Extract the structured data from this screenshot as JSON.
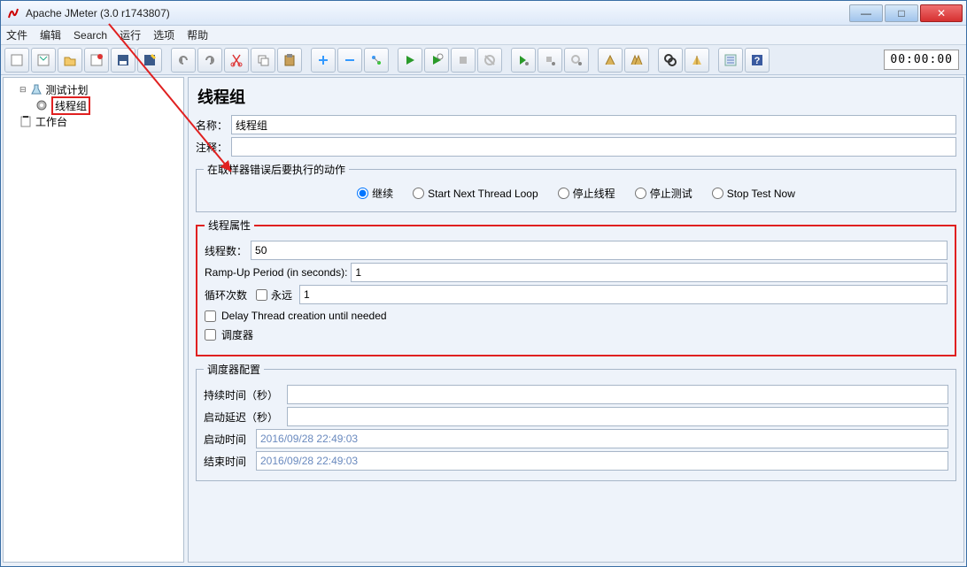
{
  "window": {
    "title": "Apache JMeter (3.0 r1743807)"
  },
  "menu": {
    "file": "文件",
    "edit": "编辑",
    "search": "Search",
    "run": "运行",
    "options": "选项",
    "help": "帮助"
  },
  "timer": "00:00:00",
  "tree": {
    "plan": "测试计划",
    "threadgroup": "线程组",
    "workbench": "工作台"
  },
  "panel": {
    "title": "线程组",
    "name_label": "名称：",
    "name_value": "线程组",
    "comment_label": "注释：",
    "comment_value": "",
    "sampler_error_legend": "在取样器错误后要执行的动作",
    "radios": {
      "continue": "继续",
      "startnext": "Start Next Thread Loop",
      "stopthread": "停止线程",
      "stoptest": "停止测试",
      "stopnow": "Stop Test Now"
    },
    "props_legend": "线程属性",
    "threads_label": "线程数：",
    "threads_value": "50",
    "ramp_label": "Ramp-Up Period (in seconds):",
    "ramp_value": "1",
    "loop_label": "循环次数",
    "forever_label": "永远",
    "loop_value": "1",
    "delay_label": "Delay Thread creation until needed",
    "sched_label": "调度器",
    "sched_legend": "调度器配置",
    "duration_label": "持续时间（秒）",
    "delaystart_label": "启动延迟（秒）",
    "start_label": "启动时间",
    "start_value": "2016/09/28 22:49:03",
    "end_label": "结束时间",
    "end_value": "2016/09/28 22:49:03"
  }
}
